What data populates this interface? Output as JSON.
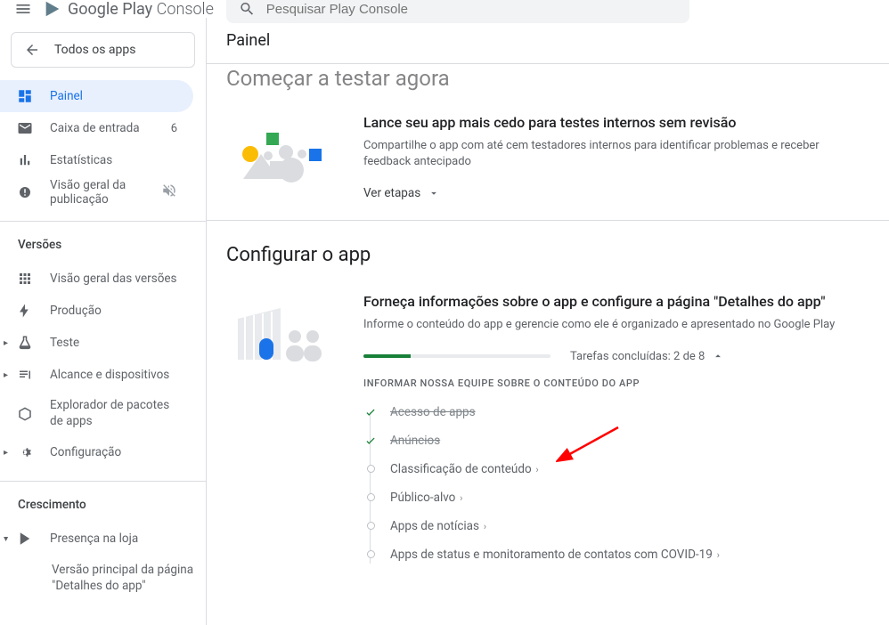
{
  "header": {
    "logo_text_1": "Google Play",
    "logo_text_2": "Console",
    "search_placeholder": "Pesquisar Play Console"
  },
  "sidebar": {
    "all_apps_label": "Todos os apps",
    "items_main": [
      {
        "label": "Painel"
      },
      {
        "label": "Caixa de entrada",
        "badge": "6"
      },
      {
        "label": "Estatísticas"
      },
      {
        "label": "Visão geral da publicação"
      }
    ],
    "section_versoes": "Versões",
    "items_versoes": [
      {
        "label": "Visão geral das versões"
      },
      {
        "label": "Produção"
      },
      {
        "label": "Teste"
      },
      {
        "label": "Alcance e dispositivos"
      },
      {
        "label": "Explorador de pacotes de apps"
      },
      {
        "label": "Configuração"
      }
    ],
    "section_crescimento": "Crescimento",
    "items_crescimento": [
      {
        "label": "Presença na loja"
      }
    ],
    "sub_item": "Versão principal da página \"Detalhes do app\""
  },
  "main": {
    "page_title": "Painel",
    "section1_title": "Começar a testar agora",
    "card1": {
      "title": "Lance seu app mais cedo para testes internos sem revisão",
      "desc": "Compartilhe o app com até cem testadores internos para identificar problemas e receber feedback antecipado",
      "cta": "Ver etapas"
    },
    "section2_title": "Configurar o app",
    "card2": {
      "title": "Forneça informações sobre o app e configure a página \"Detalhes do app\"",
      "desc": "Informe o conteúdo do app e gerencie como ele é organizado e apresentado no Google Play",
      "progress_text": "Tarefas concluídas: 2 de 8",
      "progress_pct": 25,
      "tasks_heading": "INFORMAR NOSSA EQUIPE SOBRE O CONTEÚDO DO APP",
      "tasks": [
        {
          "label": "Acesso de apps",
          "done": true
        },
        {
          "label": "Anúncios",
          "done": true
        },
        {
          "label": "Classificação de conteúdo",
          "done": false
        },
        {
          "label": "Público-alvo",
          "done": false
        },
        {
          "label": "Apps de notícias",
          "done": false
        },
        {
          "label": "Apps de status e monitoramento de contatos com COVID-19",
          "done": false
        }
      ]
    }
  },
  "colors": {
    "accent": "#1a73e8",
    "success": "#188038",
    "muted": "#5f6368"
  }
}
